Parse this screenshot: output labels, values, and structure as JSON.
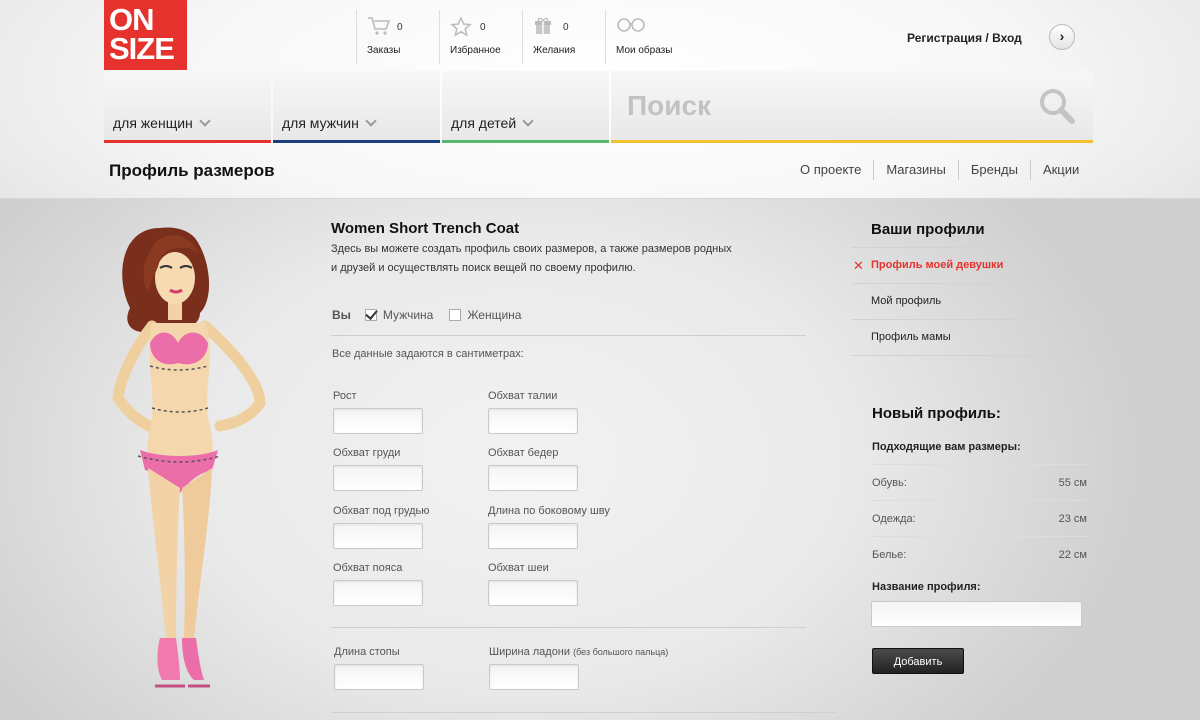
{
  "header": {
    "logo": [
      "ON",
      "SIZE"
    ],
    "nav": [
      {
        "label": "Заказы",
        "count": "0",
        "icon": "cart-icon"
      },
      {
        "label": "Избранное",
        "count": "0",
        "icon": "star-icon"
      },
      {
        "label": "Желания",
        "count": "0",
        "icon": "gift-icon"
      },
      {
        "label": "Мои образы",
        "count": "",
        "icon": "glasses-icon"
      }
    ],
    "auth_link": "Регистрация / Вход"
  },
  "categories": [
    {
      "label": "для женщин",
      "color": "#e5322d"
    },
    {
      "label": "для мужчин",
      "color": "#1c3d7c"
    },
    {
      "label": "для детей",
      "color": "#56b870"
    }
  ],
  "search": {
    "placeholder": "Поиск",
    "accent": "#f1c230"
  },
  "subheader": {
    "title": "Профиль размеров",
    "links": [
      "О проекте",
      "Магазины",
      "Бренды",
      "Акции"
    ]
  },
  "form": {
    "title": "Women Short Trench Coat",
    "description_line1": "Здесь вы можете создать профиль своих размеров, а также размеров родных",
    "description_line2": "и друзей и осуществлять поиск вещей по своему профилю.",
    "gender_label": "Вы",
    "gender_options": [
      {
        "label": "Мужчина",
        "checked": true
      },
      {
        "label": "Женщина",
        "checked": false
      }
    ],
    "units_note": "Все данные задаются в сантиметрах:",
    "fields": [
      {
        "label": "Рост"
      },
      {
        "label": "Обхват талии"
      },
      {
        "label": "Обхват груди"
      },
      {
        "label": "Обхват бедер"
      },
      {
        "label": "Обхват под грудью"
      },
      {
        "label": "Длина по боковому шву"
      },
      {
        "label": "Обхват пояса"
      },
      {
        "label": "Обхват шеи"
      },
      {
        "label": "Длина стопы"
      },
      {
        "label": "Ширина ладони",
        "note": "(без большого пальца)"
      }
    ]
  },
  "sidebar": {
    "profiles_title": "Ваши профили",
    "profiles": [
      {
        "label": "Профиль моей девушки",
        "active": true
      },
      {
        "label": "Мой профиль",
        "active": false
      },
      {
        "label": "Профиль мамы",
        "active": false
      }
    ],
    "new_profile_title": "Новый профиль:",
    "sizes_title": "Подходящие вам размеры:",
    "sizes": [
      {
        "label": "Обувь:",
        "value": "55 см"
      },
      {
        "label": "Одежда:",
        "value": "23 см"
      },
      {
        "label": "Белье:",
        "value": "22 см"
      }
    ],
    "name_label": "Название профиля:",
    "add_button": "Добавить"
  },
  "colors": {
    "brand": "#e5322d",
    "active_profile": "#e5322d"
  }
}
